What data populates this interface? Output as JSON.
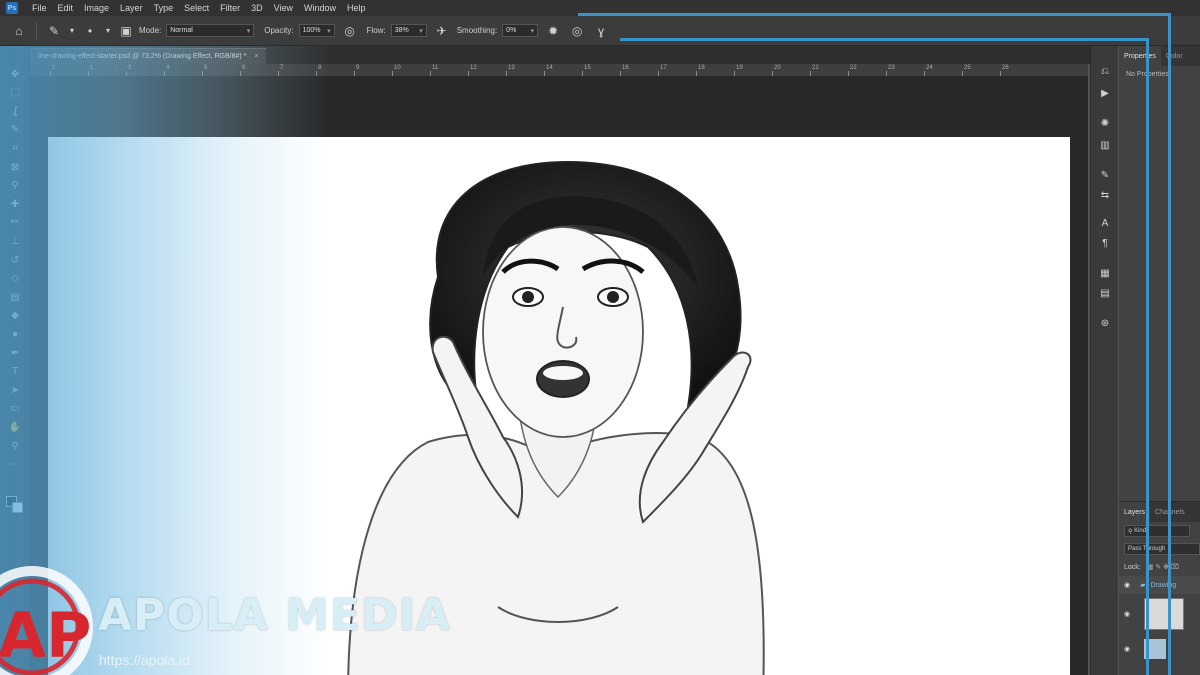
{
  "menubar": {
    "items": [
      "File",
      "Edit",
      "Image",
      "Layer",
      "Type",
      "Select",
      "Filter",
      "3D",
      "View",
      "Window",
      "Help"
    ]
  },
  "options": {
    "mode_label": "Mode:",
    "mode_value": "Normal",
    "opacity_label": "Opacity:",
    "opacity_value": "100%",
    "flow_label": "Flow:",
    "flow_value": "38%",
    "smoothing_label": "Smoothing:",
    "smoothing_value": "0%"
  },
  "document": {
    "tab_title": "line-drawing-effect-starter.psd @ 73.2% (Drawing Effect, RGB/8#) *",
    "close": "×"
  },
  "ruler": {
    "labels": [
      "2",
      "1",
      "3",
      "4",
      "5",
      "6",
      "7",
      "8",
      "9",
      "10",
      "11",
      "12",
      "13",
      "14",
      "15",
      "16",
      "17",
      "18",
      "19",
      "20",
      "21",
      "22",
      "23",
      "24",
      "25",
      "26"
    ]
  },
  "tools": [
    "move-icon",
    "marquee-icon",
    "lasso-icon",
    "quick-select-icon",
    "crop-icon",
    "frame-icon",
    "eyedropper-icon",
    "healing-icon",
    "brush-icon",
    "stamp-icon",
    "history-brush-icon",
    "eraser-icon",
    "gradient-icon",
    "blur-icon",
    "dodge-icon",
    "pen-icon",
    "type-icon",
    "path-select-icon",
    "rectangle-icon",
    "hand-icon",
    "zoom-icon",
    "more-icon"
  ],
  "panels": {
    "properties_tab": "Properties",
    "color_tab": "Color",
    "no_properties": "No Properties",
    "layers_tab": "Layers",
    "channels_tab": "Channels",
    "kind_value": "Kind",
    "blend_value": "Pass Through",
    "lock_label": "Lock:",
    "group_name": "Drawing"
  },
  "watermark": {
    "logo_letters": "AP",
    "brand": "APOLA MEDIA",
    "url": "https://apola.id"
  },
  "colors": {
    "accent_blue": "#3a94c8",
    "brand_red": "#d8262e"
  }
}
